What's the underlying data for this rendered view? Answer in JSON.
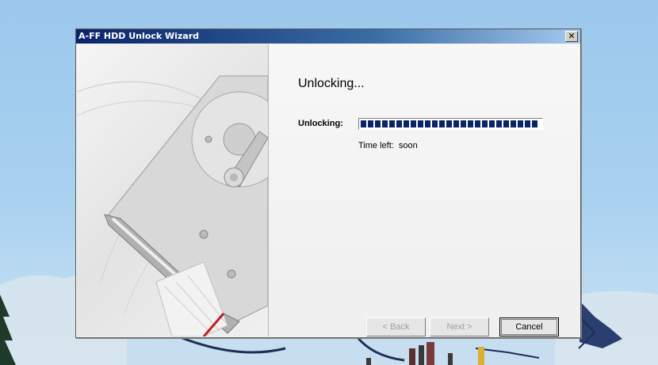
{
  "window": {
    "title": "A-FF HDD Unlock Wizard",
    "close_label": "✕"
  },
  "content": {
    "heading": "Unlocking...",
    "progress_label": "Unlocking:",
    "progress_fraction": 1.0,
    "time_left_label": "Time left:",
    "time_left_value": "soon"
  },
  "buttons": {
    "back": "< Back",
    "next": "Next >",
    "cancel": "Cancel"
  },
  "colors": {
    "titlebar_start": "#0a246a",
    "progress": "#0a246a",
    "sky": "#a9d1f0"
  },
  "icons": {
    "side_image": "hard-drive-illustration",
    "close": "close-icon"
  }
}
